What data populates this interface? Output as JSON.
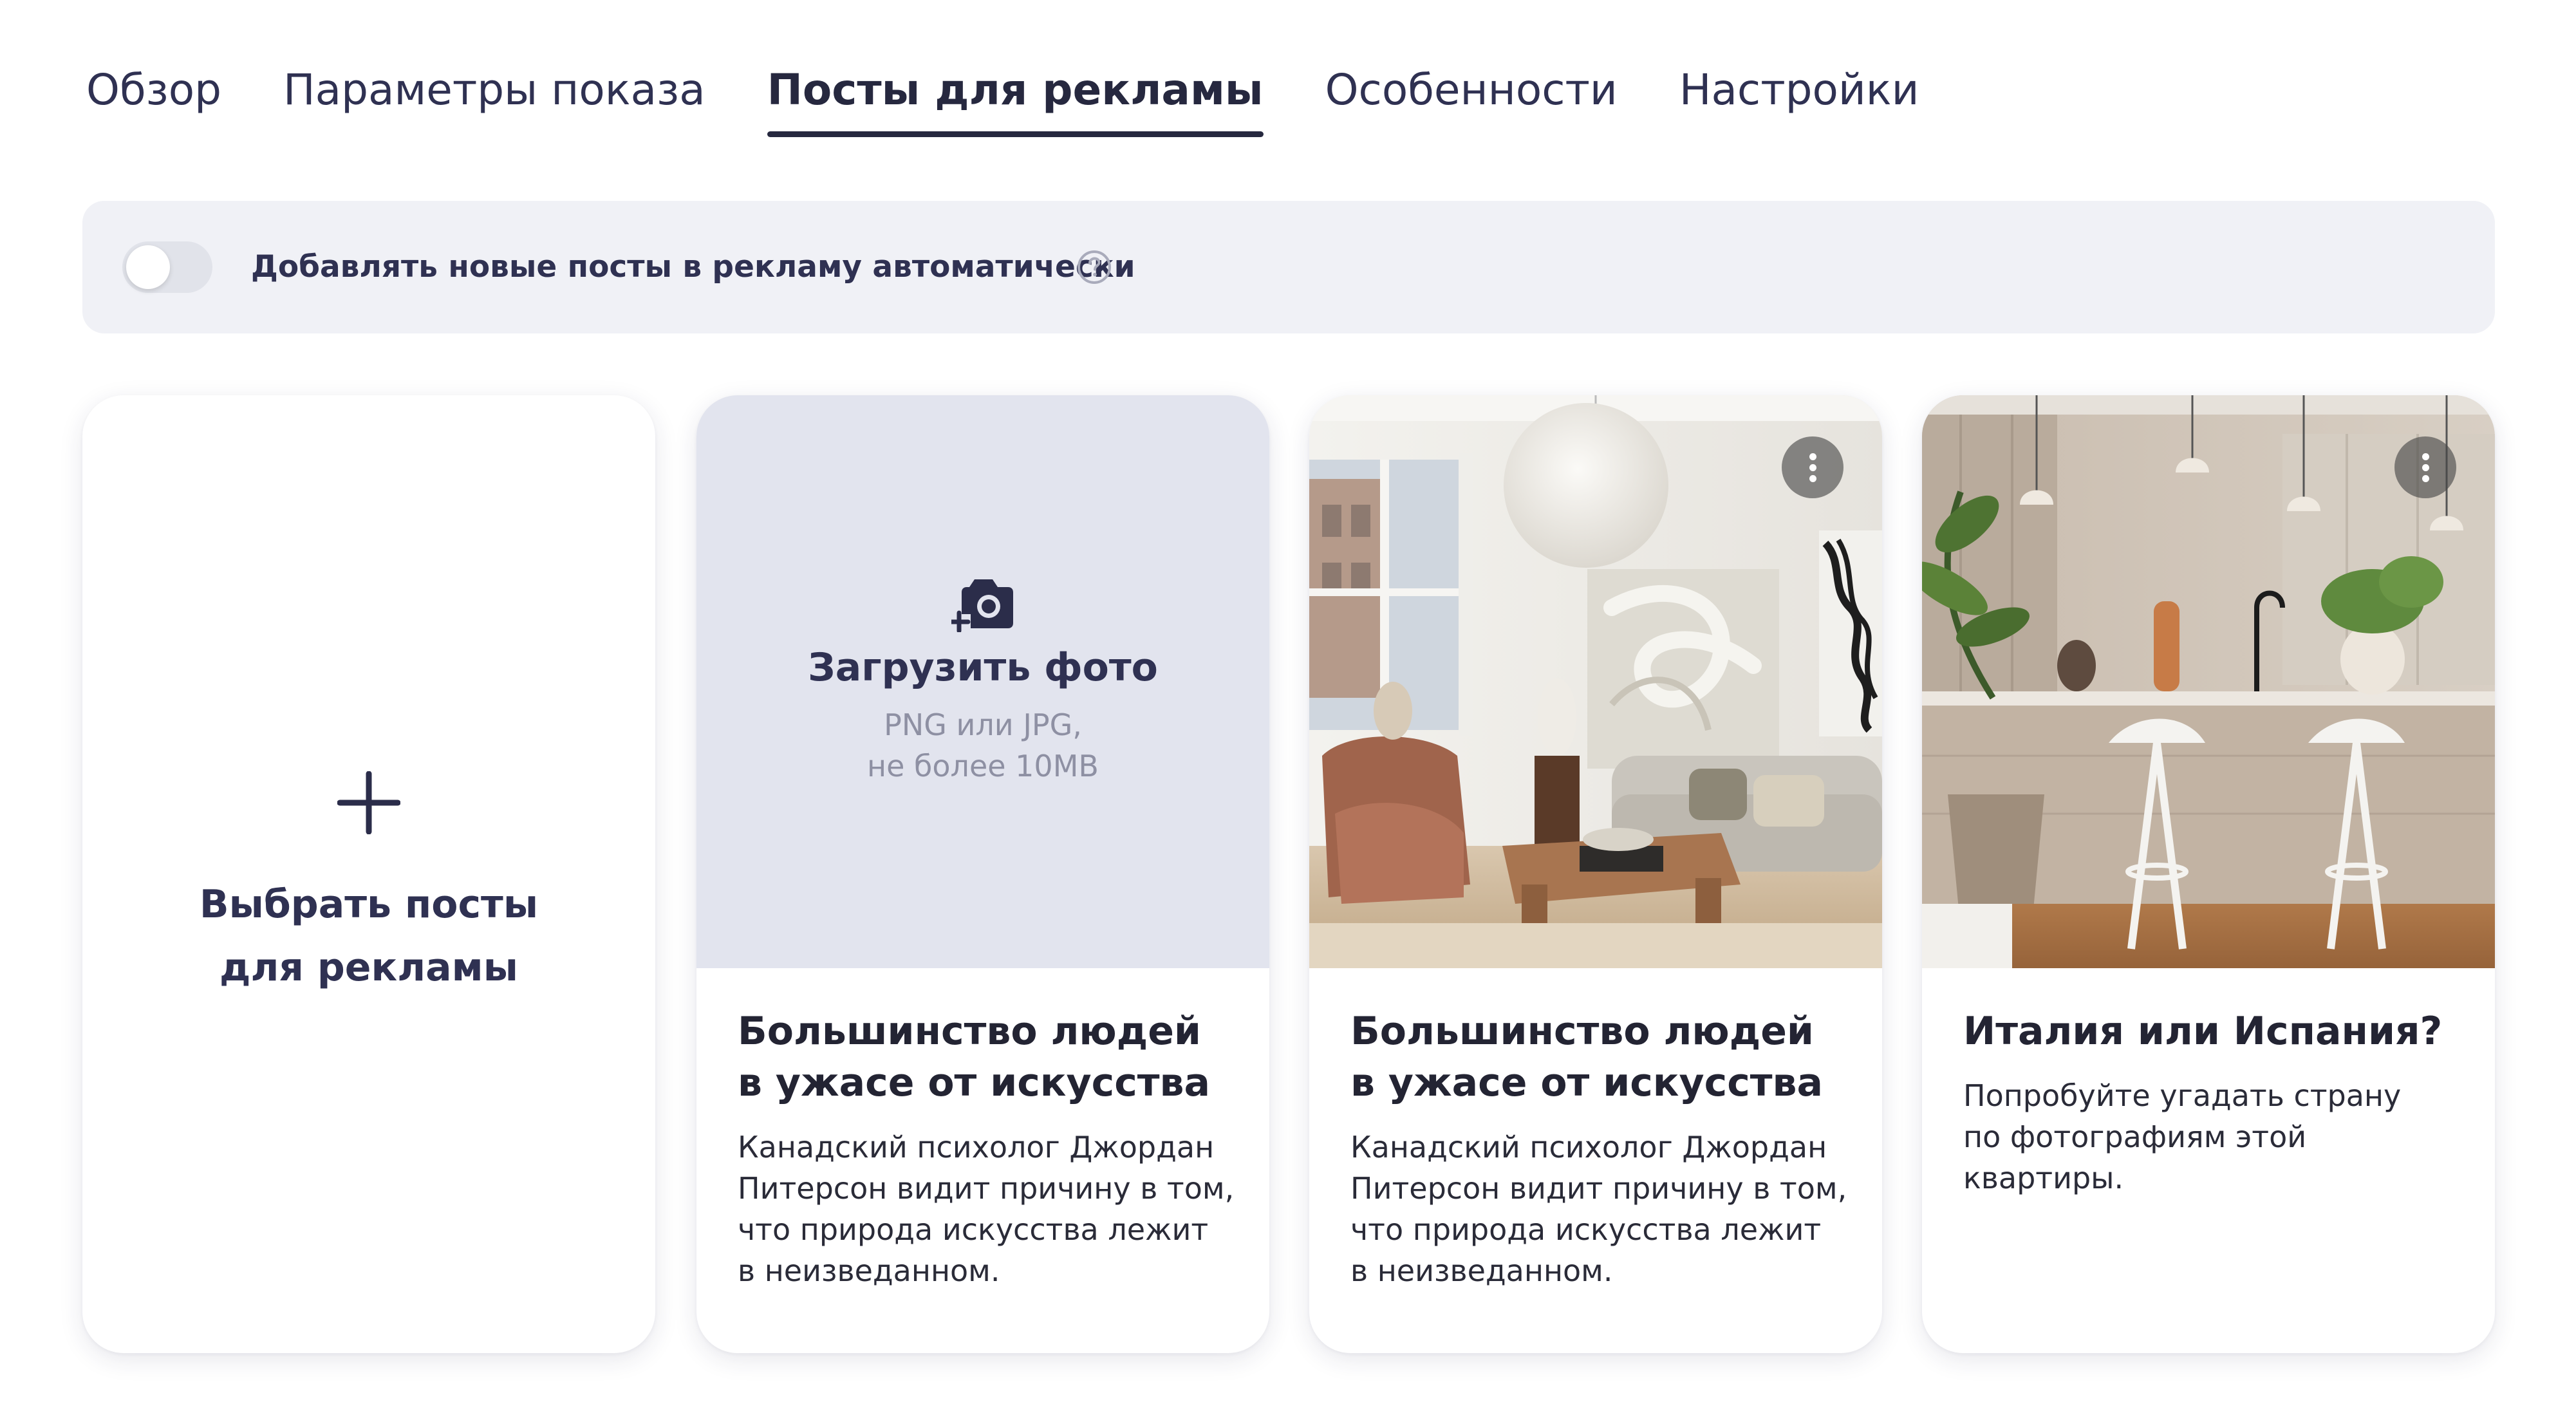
{
  "tabs": [
    {
      "label": "Обзор",
      "active": false
    },
    {
      "label": "Параметры показа",
      "active": false
    },
    {
      "label": "Посты для рекламы",
      "active": true
    },
    {
      "label": "Особенности",
      "active": false
    },
    {
      "label": "Настройки",
      "active": false
    }
  ],
  "auto_add": {
    "label": "Добавлять новые посты в рекламу автоматически",
    "enabled": false,
    "help_icon": "question-circle-icon"
  },
  "choose_card": {
    "icon": "plus-icon",
    "label_line1": "Выбрать посты",
    "label_line2": "для рекламы"
  },
  "upload_card": {
    "icon": "camera-add-icon",
    "title": "Загрузить фото",
    "hint_line1": "PNG или JPG,",
    "hint_line2": "не более 10MB",
    "title_line1": "Большинство людей",
    "title_line2": "в ужасе от искусства",
    "body_line1": "Канадский психолог Джордан",
    "body_line2": "Питерсон видит причину в том,",
    "body_line3": "что природа искусства лежит",
    "body_line4": "в неизведанном."
  },
  "posts": [
    {
      "image": "living-room-photo",
      "title_line1": "Большинство людей",
      "title_line2": "в ужасе от искусства",
      "body_line1": "Канадский психолог Джордан",
      "body_line2": "Питерсон видит причину в том,",
      "body_line3": "что природа искусства лежит",
      "body_line4": "в неизведанном."
    },
    {
      "image": "kitchen-photo",
      "title_line1": "Италия или Испания?",
      "body_line1": "Попробуйте угадать страну",
      "body_line2": "по фотографиям этой квартиры."
    }
  ],
  "colors": {
    "text_primary": "#2f3152",
    "bar_background": "#f0f1f6",
    "upload_background": "#e2e4ee",
    "hint_text": "#8e90a3"
  }
}
